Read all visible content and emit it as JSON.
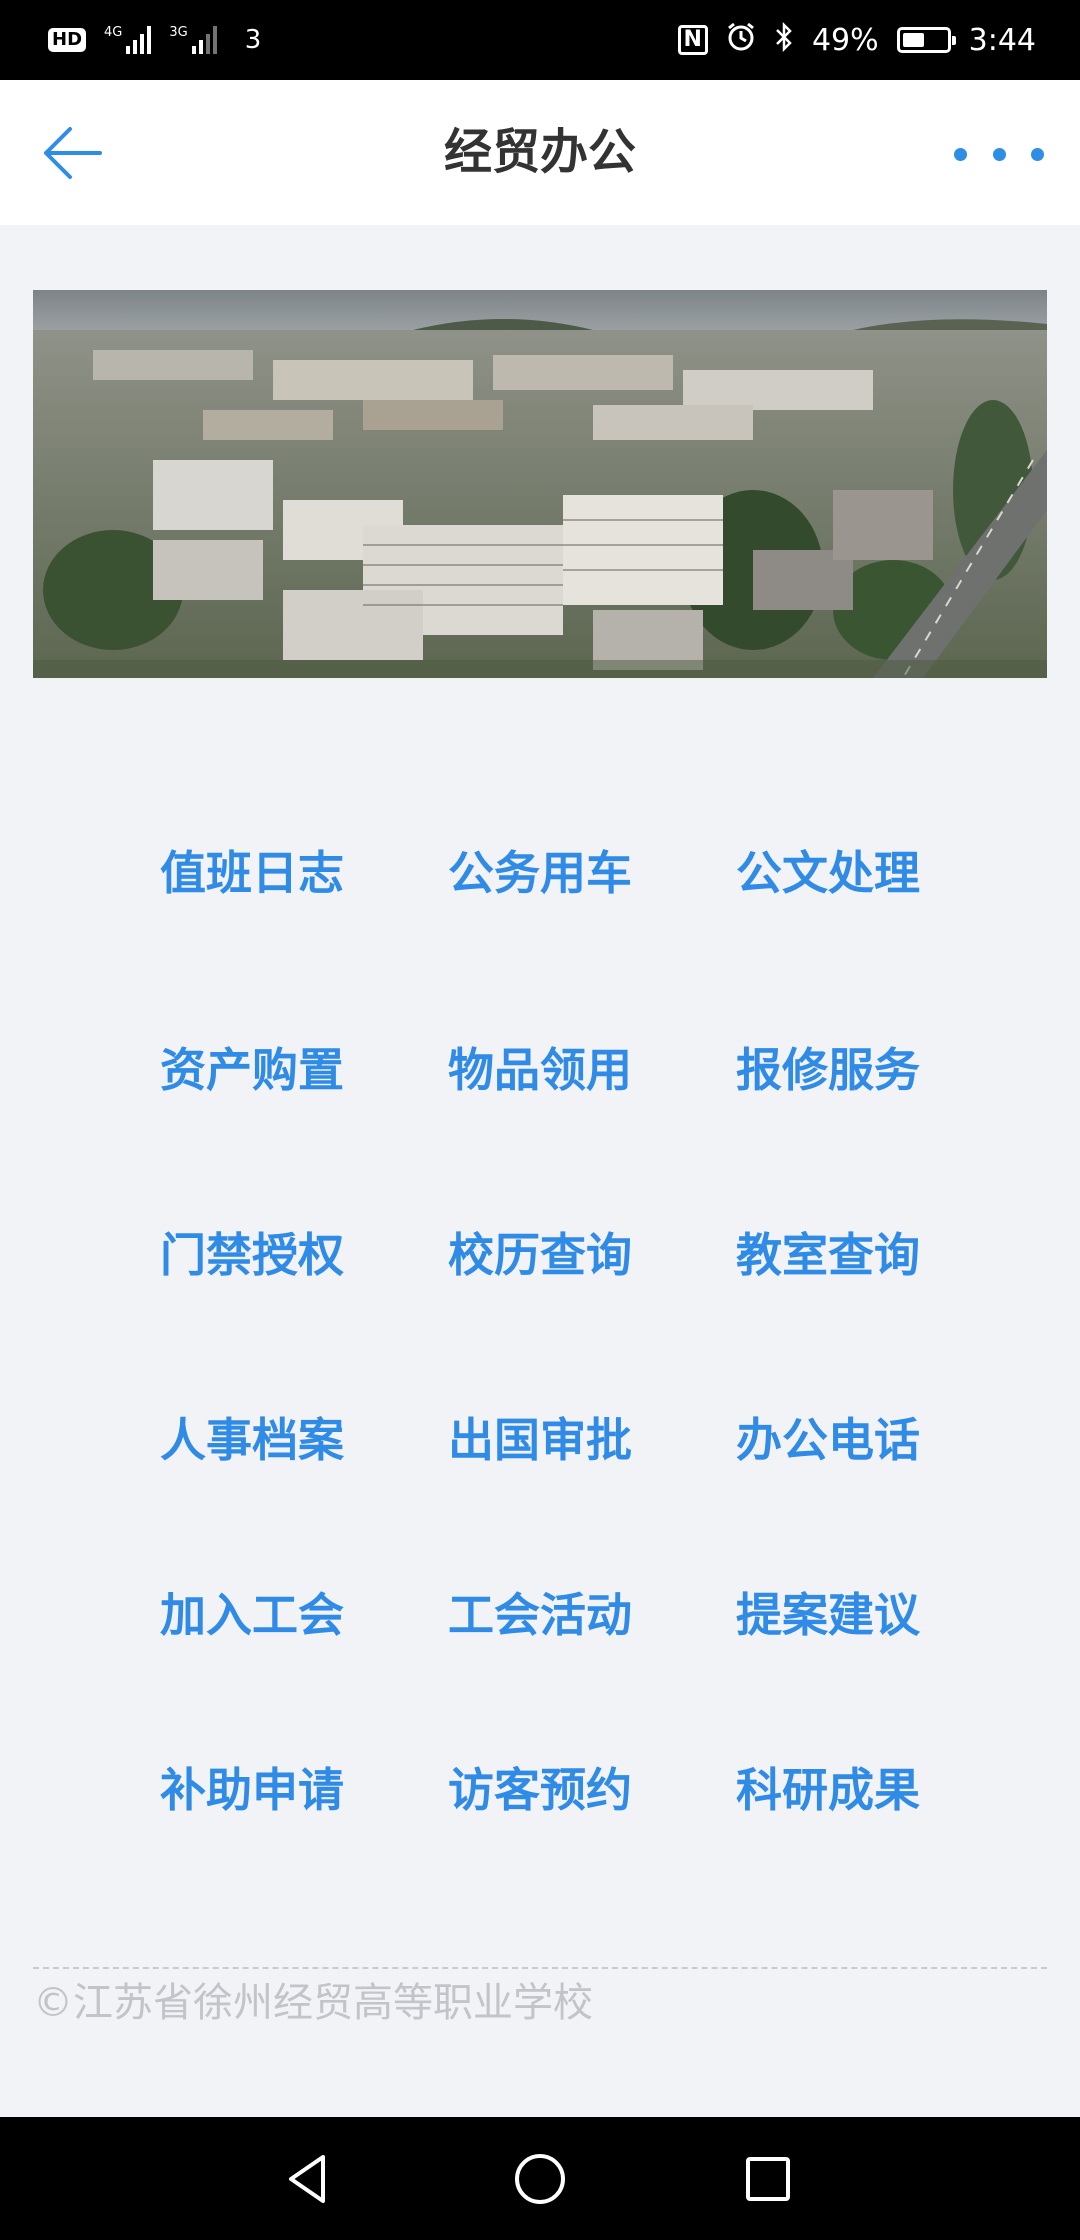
{
  "status_bar": {
    "hd_label": "HD",
    "net1_label": "4G",
    "net2_label": "3G",
    "sim_label": "3",
    "nfc_label": "N",
    "battery_text": "49%",
    "battery_level": 0.49,
    "time": "3:44"
  },
  "header": {
    "title": "经贸办公",
    "back_icon": "arrow-left-icon",
    "more_icon": "more-dots-icon",
    "accent_color": "#2e8ee6"
  },
  "banner": {
    "image": "aerial-campus-photo"
  },
  "menu": {
    "items": [
      {
        "label": "值班日志"
      },
      {
        "label": "公务用车"
      },
      {
        "label": "公文处理"
      },
      {
        "label": "资产购置"
      },
      {
        "label": "物品领用"
      },
      {
        "label": "报修服务"
      },
      {
        "label": "门禁授权"
      },
      {
        "label": "校历查询"
      },
      {
        "label": "教室查询"
      },
      {
        "label": "人事档案"
      },
      {
        "label": "出国审批"
      },
      {
        "label": "办公电话"
      },
      {
        "label": "加入工会"
      },
      {
        "label": "工会活动"
      },
      {
        "label": "提案建议"
      },
      {
        "label": "补助申请"
      },
      {
        "label": "访客预约"
      },
      {
        "label": "科研成果"
      }
    ],
    "label_color": "#2f8be6"
  },
  "footer": {
    "copyright": "©江苏省徐州经贸高等职业学校"
  },
  "system_nav": {
    "back_icon": "triangle-back-icon",
    "home_icon": "circle-home-icon",
    "recents_icon": "square-recents-icon"
  }
}
